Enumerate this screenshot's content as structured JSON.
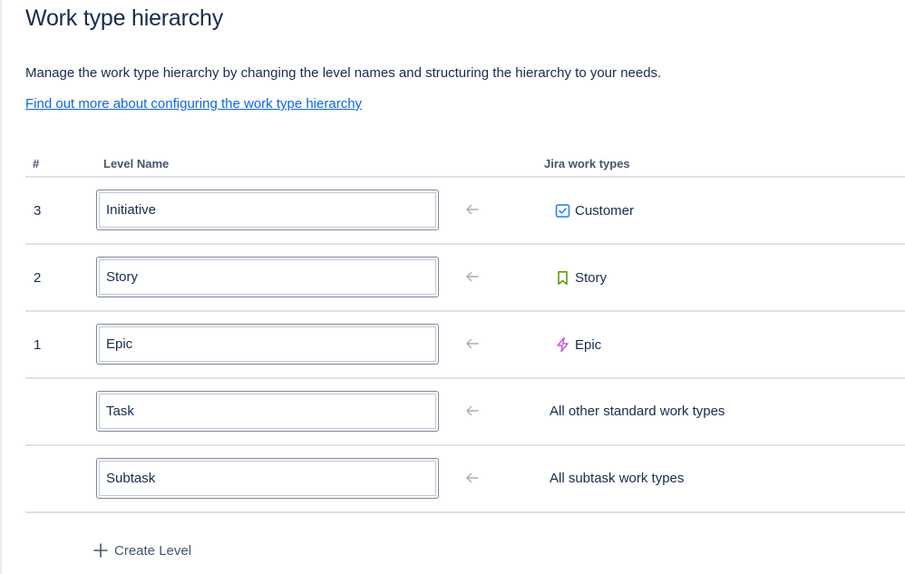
{
  "header": {
    "title": "Work type hierarchy",
    "description": "Manage the work type hierarchy by changing the level names and structuring the hierarchy to your needs.",
    "help_link": "Find out more about configuring the work type hierarchy"
  },
  "table": {
    "columns": {
      "num": "#",
      "level_name": "Level Name",
      "jira_types": "Jira work types"
    },
    "rows": [
      {
        "num": "3",
        "level_name": "Initiative",
        "type_label": "Customer",
        "type_icon": "checkbox-icon",
        "icon_color": "#1d7afc"
      },
      {
        "num": "2",
        "level_name": "Story",
        "type_label": "Story",
        "type_icon": "bookmark-icon",
        "icon_color": "#5b9b13"
      },
      {
        "num": "1",
        "level_name": "Epic",
        "type_label": "Epic",
        "type_icon": "lightning-icon",
        "icon_color": "#c25fd9"
      },
      {
        "num": "",
        "level_name": "Task",
        "type_label": "All other standard work types"
      },
      {
        "num": "",
        "level_name": "Subtask",
        "type_label": "All subtask work types"
      }
    ]
  },
  "actions": {
    "create_level": "Create Level"
  },
  "colors": {
    "link": "#0c66e4",
    "text": "#172b4d",
    "divider": "#dfe1e6"
  }
}
